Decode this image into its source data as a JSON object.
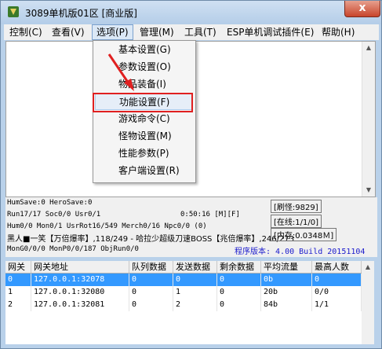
{
  "window": {
    "title": "3089单机版01区 [商业版]",
    "close_label": "x"
  },
  "menubar": {
    "items": [
      "控制(C)",
      "查看(V)",
      "选项(P)",
      "管理(M)",
      "工具(T)",
      "ESP单机调试插件(E)",
      "帮助(H)"
    ]
  },
  "dropdown": {
    "items": [
      "基本设置(G)",
      "参数设置(O)",
      "物品装备(I)",
      "功能设置(F)",
      "游戏命令(C)",
      "怪物设置(M)",
      "性能参数(P)",
      "客户端设置(R)"
    ]
  },
  "status": {
    "line1": "HumSave:0 HeroSave:0",
    "line2": "Run17/17 Soc0/0 Usr0/1",
    "time": "0:50:16 [M][F]",
    "line3": "Hum0/0 Mon0/1 UsrRot16/549 Merch0/16 Npc0/0 (0)",
    "line4": "黑人■一笑【万倍爆率】,118/249 - 哈拉少超级刀速BOSS【兆倍爆率】,246/273",
    "line5": "MonG0/0/0 MonP0/0/187 ObjRun0/0",
    "monsters": "[刷怪:9829]",
    "online": "[在线:1/1/0]",
    "memory": "[内存:0.0348Ｍ]",
    "version": "程序版本: 4.00 Build 20151104"
  },
  "grid": {
    "headers": [
      "网关",
      "网关地址",
      "队列数据",
      "发送数据",
      "剩余数据",
      "平均流量",
      "最高人数"
    ],
    "rows": [
      [
        "0",
        "127.0.0.1:32078",
        "0",
        "0",
        "0",
        "0b",
        "0"
      ],
      [
        "1",
        "127.0.0.1:32080",
        "0",
        "1",
        "0",
        "20b",
        "0/0"
      ],
      [
        "2",
        "127.0.0.1:32081",
        "0",
        "2",
        "0",
        "84b",
        "1/1"
      ]
    ]
  },
  "colors": {
    "selection": "#3399ff",
    "highlight_box": "#e02020",
    "version_text": "#1a1acc"
  }
}
